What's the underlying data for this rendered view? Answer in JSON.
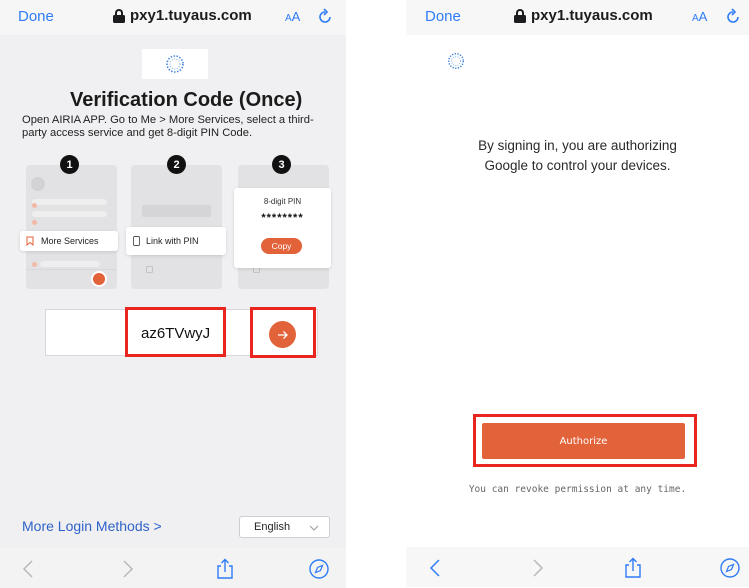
{
  "left": {
    "browser": {
      "done_label": "Done",
      "url": "pxy1.tuyaus.com",
      "text_size_label_small": "A",
      "text_size_label_large": "A"
    },
    "title": "Verification Code (Once)",
    "description": "Open AIRIA APP. Go to Me > More Services, select a third-party access service and get 8-digit PIN Code.",
    "steps": [
      {
        "number": "1",
        "card_label": "More Services"
      },
      {
        "number": "2",
        "card_label": "Link with PIN"
      },
      {
        "number": "3",
        "pin_label": "8-digit PIN",
        "pin_value": "********",
        "copy_label": "Copy"
      }
    ],
    "pin_input_value": "az6TVwyJ",
    "more_login_methods": "More Login Methods >",
    "language": {
      "selected": "English"
    }
  },
  "right": {
    "browser": {
      "done_label": "Done",
      "url": "pxy1.tuyaus.com",
      "text_size_label_small": "A",
      "text_size_label_large": "A"
    },
    "message_line1": "By signing in, you are authorizing",
    "message_line2": "Google to control your devices.",
    "authorize_label": "Authorize",
    "revoke_note": "You can revoke permission at any time."
  },
  "colors": {
    "accent": "#e2623a",
    "ios_blue": "#2f7cf6",
    "link_blue": "#2f62c8",
    "highlight_red": "#e8261f"
  },
  "icons": [
    "lock-icon",
    "reload-icon",
    "back-icon",
    "forward-icon",
    "share-icon",
    "compass-icon",
    "brand-logo-icon",
    "arrow-right-icon",
    "bookmark-icon",
    "phone-icon",
    "avatar-icon",
    "chevron-down-icon"
  ]
}
